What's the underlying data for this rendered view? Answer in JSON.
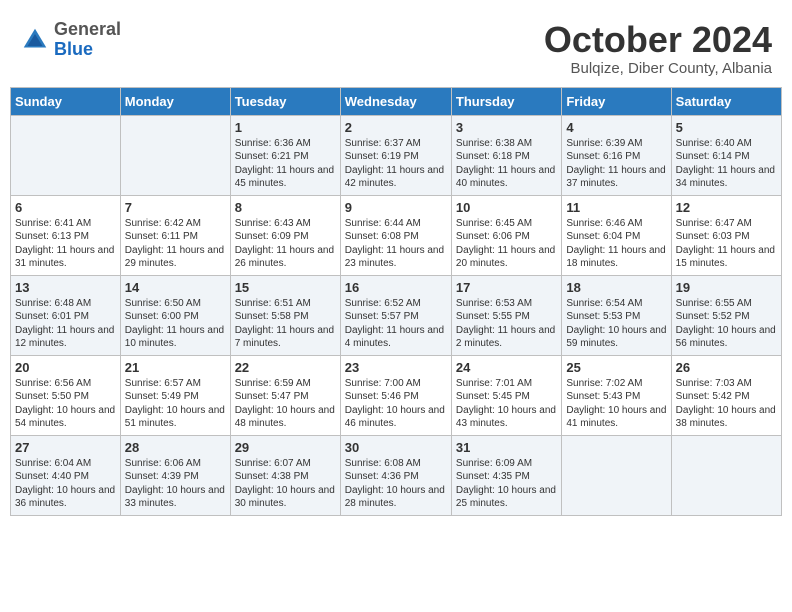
{
  "header": {
    "logo": {
      "general": "General",
      "blue": "Blue"
    },
    "title": "October 2024",
    "location": "Bulqize, Diber County, Albania"
  },
  "weekdays": [
    "Sunday",
    "Monday",
    "Tuesday",
    "Wednesday",
    "Thursday",
    "Friday",
    "Saturday"
  ],
  "weeks": [
    [
      {
        "day": "",
        "sunrise": "",
        "sunset": "",
        "daylight": ""
      },
      {
        "day": "",
        "sunrise": "",
        "sunset": "",
        "daylight": ""
      },
      {
        "day": "1",
        "sunrise": "Sunrise: 6:36 AM",
        "sunset": "Sunset: 6:21 PM",
        "daylight": "Daylight: 11 hours and 45 minutes."
      },
      {
        "day": "2",
        "sunrise": "Sunrise: 6:37 AM",
        "sunset": "Sunset: 6:19 PM",
        "daylight": "Daylight: 11 hours and 42 minutes."
      },
      {
        "day": "3",
        "sunrise": "Sunrise: 6:38 AM",
        "sunset": "Sunset: 6:18 PM",
        "daylight": "Daylight: 11 hours and 40 minutes."
      },
      {
        "day": "4",
        "sunrise": "Sunrise: 6:39 AM",
        "sunset": "Sunset: 6:16 PM",
        "daylight": "Daylight: 11 hours and 37 minutes."
      },
      {
        "day": "5",
        "sunrise": "Sunrise: 6:40 AM",
        "sunset": "Sunset: 6:14 PM",
        "daylight": "Daylight: 11 hours and 34 minutes."
      }
    ],
    [
      {
        "day": "6",
        "sunrise": "Sunrise: 6:41 AM",
        "sunset": "Sunset: 6:13 PM",
        "daylight": "Daylight: 11 hours and 31 minutes."
      },
      {
        "day": "7",
        "sunrise": "Sunrise: 6:42 AM",
        "sunset": "Sunset: 6:11 PM",
        "daylight": "Daylight: 11 hours and 29 minutes."
      },
      {
        "day": "8",
        "sunrise": "Sunrise: 6:43 AM",
        "sunset": "Sunset: 6:09 PM",
        "daylight": "Daylight: 11 hours and 26 minutes."
      },
      {
        "day": "9",
        "sunrise": "Sunrise: 6:44 AM",
        "sunset": "Sunset: 6:08 PM",
        "daylight": "Daylight: 11 hours and 23 minutes."
      },
      {
        "day": "10",
        "sunrise": "Sunrise: 6:45 AM",
        "sunset": "Sunset: 6:06 PM",
        "daylight": "Daylight: 11 hours and 20 minutes."
      },
      {
        "day": "11",
        "sunrise": "Sunrise: 6:46 AM",
        "sunset": "Sunset: 6:04 PM",
        "daylight": "Daylight: 11 hours and 18 minutes."
      },
      {
        "day": "12",
        "sunrise": "Sunrise: 6:47 AM",
        "sunset": "Sunset: 6:03 PM",
        "daylight": "Daylight: 11 hours and 15 minutes."
      }
    ],
    [
      {
        "day": "13",
        "sunrise": "Sunrise: 6:48 AM",
        "sunset": "Sunset: 6:01 PM",
        "daylight": "Daylight: 11 hours and 12 minutes."
      },
      {
        "day": "14",
        "sunrise": "Sunrise: 6:50 AM",
        "sunset": "Sunset: 6:00 PM",
        "daylight": "Daylight: 11 hours and 10 minutes."
      },
      {
        "day": "15",
        "sunrise": "Sunrise: 6:51 AM",
        "sunset": "Sunset: 5:58 PM",
        "daylight": "Daylight: 11 hours and 7 minutes."
      },
      {
        "day": "16",
        "sunrise": "Sunrise: 6:52 AM",
        "sunset": "Sunset: 5:57 PM",
        "daylight": "Daylight: 11 hours and 4 minutes."
      },
      {
        "day": "17",
        "sunrise": "Sunrise: 6:53 AM",
        "sunset": "Sunset: 5:55 PM",
        "daylight": "Daylight: 11 hours and 2 minutes."
      },
      {
        "day": "18",
        "sunrise": "Sunrise: 6:54 AM",
        "sunset": "Sunset: 5:53 PM",
        "daylight": "Daylight: 10 hours and 59 minutes."
      },
      {
        "day": "19",
        "sunrise": "Sunrise: 6:55 AM",
        "sunset": "Sunset: 5:52 PM",
        "daylight": "Daylight: 10 hours and 56 minutes."
      }
    ],
    [
      {
        "day": "20",
        "sunrise": "Sunrise: 6:56 AM",
        "sunset": "Sunset: 5:50 PM",
        "daylight": "Daylight: 10 hours and 54 minutes."
      },
      {
        "day": "21",
        "sunrise": "Sunrise: 6:57 AM",
        "sunset": "Sunset: 5:49 PM",
        "daylight": "Daylight: 10 hours and 51 minutes."
      },
      {
        "day": "22",
        "sunrise": "Sunrise: 6:59 AM",
        "sunset": "Sunset: 5:47 PM",
        "daylight": "Daylight: 10 hours and 48 minutes."
      },
      {
        "day": "23",
        "sunrise": "Sunrise: 7:00 AM",
        "sunset": "Sunset: 5:46 PM",
        "daylight": "Daylight: 10 hours and 46 minutes."
      },
      {
        "day": "24",
        "sunrise": "Sunrise: 7:01 AM",
        "sunset": "Sunset: 5:45 PM",
        "daylight": "Daylight: 10 hours and 43 minutes."
      },
      {
        "day": "25",
        "sunrise": "Sunrise: 7:02 AM",
        "sunset": "Sunset: 5:43 PM",
        "daylight": "Daylight: 10 hours and 41 minutes."
      },
      {
        "day": "26",
        "sunrise": "Sunrise: 7:03 AM",
        "sunset": "Sunset: 5:42 PM",
        "daylight": "Daylight: 10 hours and 38 minutes."
      }
    ],
    [
      {
        "day": "27",
        "sunrise": "Sunrise: 6:04 AM",
        "sunset": "Sunset: 4:40 PM",
        "daylight": "Daylight: 10 hours and 36 minutes."
      },
      {
        "day": "28",
        "sunrise": "Sunrise: 6:06 AM",
        "sunset": "Sunset: 4:39 PM",
        "daylight": "Daylight: 10 hours and 33 minutes."
      },
      {
        "day": "29",
        "sunrise": "Sunrise: 6:07 AM",
        "sunset": "Sunset: 4:38 PM",
        "daylight": "Daylight: 10 hours and 30 minutes."
      },
      {
        "day": "30",
        "sunrise": "Sunrise: 6:08 AM",
        "sunset": "Sunset: 4:36 PM",
        "daylight": "Daylight: 10 hours and 28 minutes."
      },
      {
        "day": "31",
        "sunrise": "Sunrise: 6:09 AM",
        "sunset": "Sunset: 4:35 PM",
        "daylight": "Daylight: 10 hours and 25 minutes."
      },
      {
        "day": "",
        "sunrise": "",
        "sunset": "",
        "daylight": ""
      },
      {
        "day": "",
        "sunrise": "",
        "sunset": "",
        "daylight": ""
      }
    ]
  ]
}
